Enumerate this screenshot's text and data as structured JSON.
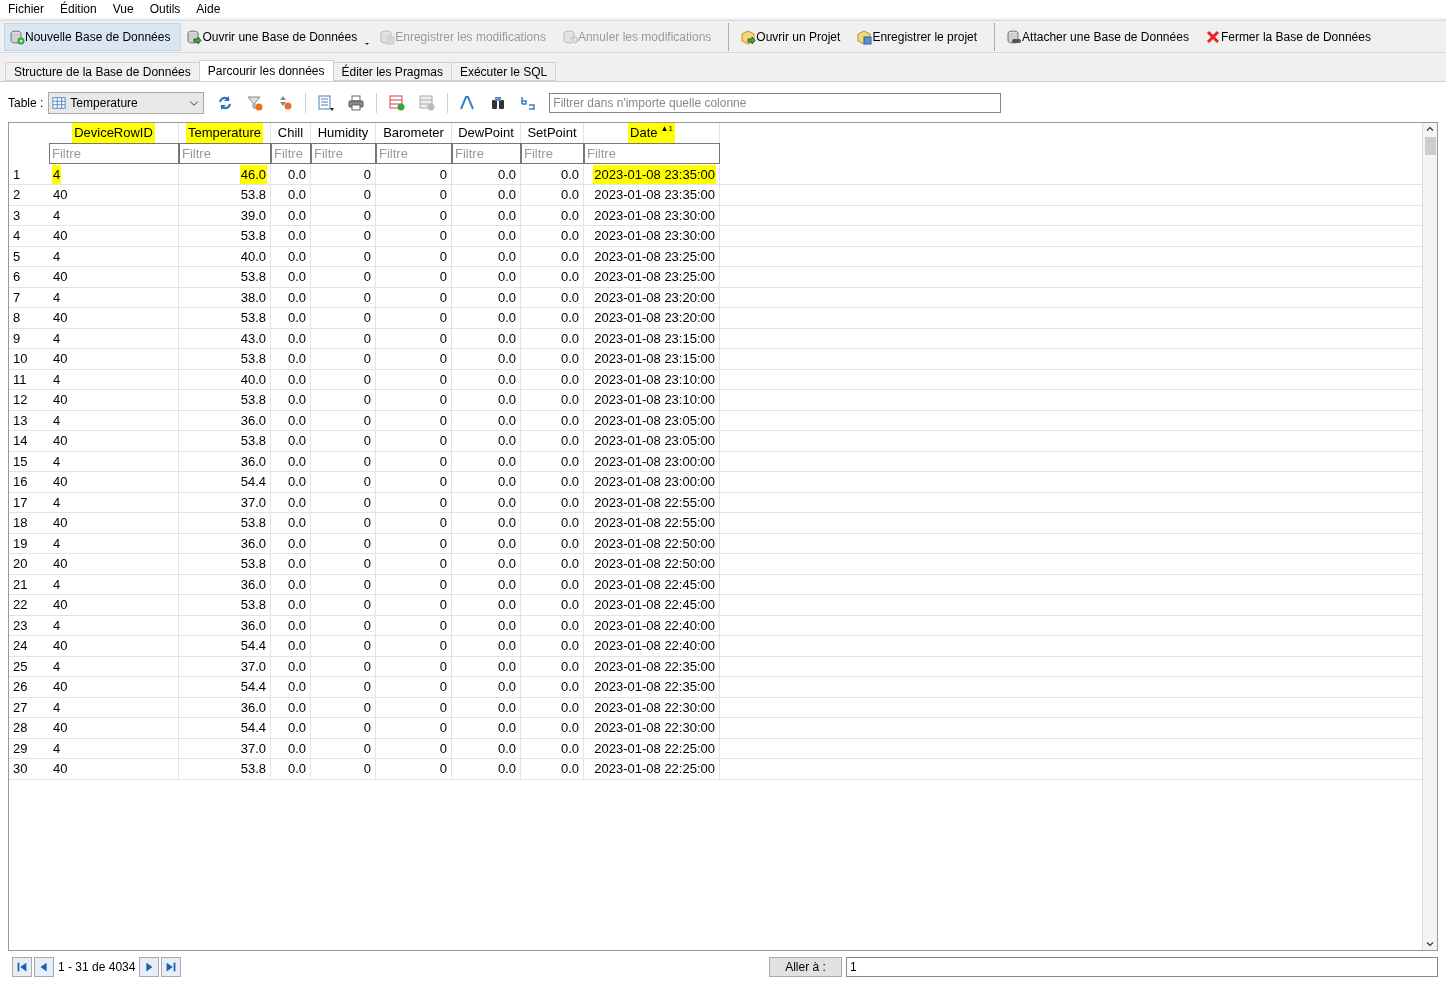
{
  "menu": [
    "Fichier",
    "Édition",
    "Vue",
    "Outils",
    "Aide"
  ],
  "toolbar": [
    [
      {
        "label": "Nouvelle Base de Données",
        "hovered": true,
        "disabled": false,
        "menu": false
      },
      {
        "label": "Ouvrir une Base de Données",
        "hovered": false,
        "disabled": false,
        "menu": true
      },
      {
        "label": "Enregistrer les modifications",
        "hovered": false,
        "disabled": true,
        "menu": false
      },
      {
        "label": "Annuler les modifications",
        "hovered": false,
        "disabled": true,
        "menu": false
      }
    ],
    [
      {
        "label": "Ouvrir un Projet",
        "hovered": false,
        "disabled": false,
        "menu": false
      },
      {
        "label": "Enregistrer le projet",
        "hovered": false,
        "disabled": false,
        "menu": false
      }
    ],
    [
      {
        "label": "Attacher une Base de Données",
        "hovered": false,
        "disabled": false,
        "menu": false
      },
      {
        "label": "Fermer la Base de Données",
        "hovered": false,
        "disabled": false,
        "menu": false
      }
    ]
  ],
  "tabs": [
    {
      "label": "Structure de la Base de Données",
      "selected": false
    },
    {
      "label": "Parcourir les données",
      "selected": true
    },
    {
      "label": "Éditer les Pragmas",
      "selected": false
    },
    {
      "label": "Exécuter le SQL",
      "selected": false
    }
  ],
  "table_label": "Table :",
  "table_select": "Temperature",
  "filter_all": {
    "placeholder": "Filtrer dans n'importe quelle colonne"
  },
  "columns": [
    {
      "name": "DeviceRowID",
      "kind": "text",
      "highlighted": true,
      "placeholder": "Filtre"
    },
    {
      "name": "Temperature",
      "kind": "number",
      "highlighted": true,
      "placeholder": "Filtre"
    },
    {
      "name": "Chill",
      "kind": "number",
      "highlighted": false,
      "placeholder": "Filtre"
    },
    {
      "name": "Humidity",
      "kind": "number",
      "highlighted": false,
      "placeholder": "Filtre"
    },
    {
      "name": "Barometer",
      "kind": "number",
      "highlighted": false,
      "placeholder": "Filtre"
    },
    {
      "name": "DewPoint",
      "kind": "number",
      "highlighted": false,
      "placeholder": "Filtre"
    },
    {
      "name": "SetPoint",
      "kind": "number",
      "highlighted": false,
      "placeholder": "Filtre"
    },
    {
      "name": "Date",
      "kind": "number",
      "highlighted": true,
      "placeholder": "Filtre",
      "sort": "▲1"
    }
  ],
  "rows": [
    {
      "number": "1",
      "cells": [
        "4",
        "46.0",
        "0.0",
        "0",
        "0",
        "0.0",
        "0.0",
        "2023-01-08 23:35:00"
      ],
      "highlights": [
        true,
        true,
        false,
        false,
        false,
        false,
        false,
        true
      ]
    },
    {
      "number": "2",
      "cells": [
        "40",
        "53.8",
        "0.0",
        "0",
        "0",
        "0.0",
        "0.0",
        "2023-01-08 23:35:00"
      ],
      "highlights": [
        false,
        false,
        false,
        false,
        false,
        false,
        false,
        false
      ]
    },
    {
      "number": "3",
      "cells": [
        "4",
        "39.0",
        "0.0",
        "0",
        "0",
        "0.0",
        "0.0",
        "2023-01-08 23:30:00"
      ],
      "highlights": [
        false,
        false,
        false,
        false,
        false,
        false,
        false,
        false
      ]
    },
    {
      "number": "4",
      "cells": [
        "40",
        "53.8",
        "0.0",
        "0",
        "0",
        "0.0",
        "0.0",
        "2023-01-08 23:30:00"
      ],
      "highlights": [
        false,
        false,
        false,
        false,
        false,
        false,
        false,
        false
      ]
    },
    {
      "number": "5",
      "cells": [
        "4",
        "40.0",
        "0.0",
        "0",
        "0",
        "0.0",
        "0.0",
        "2023-01-08 23:25:00"
      ],
      "highlights": [
        false,
        false,
        false,
        false,
        false,
        false,
        false,
        false
      ]
    },
    {
      "number": "6",
      "cells": [
        "40",
        "53.8",
        "0.0",
        "0",
        "0",
        "0.0",
        "0.0",
        "2023-01-08 23:25:00"
      ],
      "highlights": [
        false,
        false,
        false,
        false,
        false,
        false,
        false,
        false
      ]
    },
    {
      "number": "7",
      "cells": [
        "4",
        "38.0",
        "0.0",
        "0",
        "0",
        "0.0",
        "0.0",
        "2023-01-08 23:20:00"
      ],
      "highlights": [
        false,
        false,
        false,
        false,
        false,
        false,
        false,
        false
      ]
    },
    {
      "number": "8",
      "cells": [
        "40",
        "53.8",
        "0.0",
        "0",
        "0",
        "0.0",
        "0.0",
        "2023-01-08 23:20:00"
      ],
      "highlights": [
        false,
        false,
        false,
        false,
        false,
        false,
        false,
        false
      ]
    },
    {
      "number": "9",
      "cells": [
        "4",
        "43.0",
        "0.0",
        "0",
        "0",
        "0.0",
        "0.0",
        "2023-01-08 23:15:00"
      ],
      "highlights": [
        false,
        false,
        false,
        false,
        false,
        false,
        false,
        false
      ]
    },
    {
      "number": "10",
      "cells": [
        "40",
        "53.8",
        "0.0",
        "0",
        "0",
        "0.0",
        "0.0",
        "2023-01-08 23:15:00"
      ],
      "highlights": [
        false,
        false,
        false,
        false,
        false,
        false,
        false,
        false
      ]
    },
    {
      "number": "11",
      "cells": [
        "4",
        "40.0",
        "0.0",
        "0",
        "0",
        "0.0",
        "0.0",
        "2023-01-08 23:10:00"
      ],
      "highlights": [
        false,
        false,
        false,
        false,
        false,
        false,
        false,
        false
      ]
    },
    {
      "number": "12",
      "cells": [
        "40",
        "53.8",
        "0.0",
        "0",
        "0",
        "0.0",
        "0.0",
        "2023-01-08 23:10:00"
      ],
      "highlights": [
        false,
        false,
        false,
        false,
        false,
        false,
        false,
        false
      ]
    },
    {
      "number": "13",
      "cells": [
        "4",
        "36.0",
        "0.0",
        "0",
        "0",
        "0.0",
        "0.0",
        "2023-01-08 23:05:00"
      ],
      "highlights": [
        false,
        false,
        false,
        false,
        false,
        false,
        false,
        false
      ]
    },
    {
      "number": "14",
      "cells": [
        "40",
        "53.8",
        "0.0",
        "0",
        "0",
        "0.0",
        "0.0",
        "2023-01-08 23:05:00"
      ],
      "highlights": [
        false,
        false,
        false,
        false,
        false,
        false,
        false,
        false
      ]
    },
    {
      "number": "15",
      "cells": [
        "4",
        "36.0",
        "0.0",
        "0",
        "0",
        "0.0",
        "0.0",
        "2023-01-08 23:00:00"
      ],
      "highlights": [
        false,
        false,
        false,
        false,
        false,
        false,
        false,
        false
      ]
    },
    {
      "number": "16",
      "cells": [
        "40",
        "54.4",
        "0.0",
        "0",
        "0",
        "0.0",
        "0.0",
        "2023-01-08 23:00:00"
      ],
      "highlights": [
        false,
        false,
        false,
        false,
        false,
        false,
        false,
        false
      ]
    },
    {
      "number": "17",
      "cells": [
        "4",
        "37.0",
        "0.0",
        "0",
        "0",
        "0.0",
        "0.0",
        "2023-01-08 22:55:00"
      ],
      "highlights": [
        false,
        false,
        false,
        false,
        false,
        false,
        false,
        false
      ]
    },
    {
      "number": "18",
      "cells": [
        "40",
        "53.8",
        "0.0",
        "0",
        "0",
        "0.0",
        "0.0",
        "2023-01-08 22:55:00"
      ],
      "highlights": [
        false,
        false,
        false,
        false,
        false,
        false,
        false,
        false
      ]
    },
    {
      "number": "19",
      "cells": [
        "4",
        "36.0",
        "0.0",
        "0",
        "0",
        "0.0",
        "0.0",
        "2023-01-08 22:50:00"
      ],
      "highlights": [
        false,
        false,
        false,
        false,
        false,
        false,
        false,
        false
      ]
    },
    {
      "number": "20",
      "cells": [
        "40",
        "53.8",
        "0.0",
        "0",
        "0",
        "0.0",
        "0.0",
        "2023-01-08 22:50:00"
      ],
      "highlights": [
        false,
        false,
        false,
        false,
        false,
        false,
        false,
        false
      ]
    },
    {
      "number": "21",
      "cells": [
        "4",
        "36.0",
        "0.0",
        "0",
        "0",
        "0.0",
        "0.0",
        "2023-01-08 22:45:00"
      ],
      "highlights": [
        false,
        false,
        false,
        false,
        false,
        false,
        false,
        false
      ]
    },
    {
      "number": "22",
      "cells": [
        "40",
        "53.8",
        "0.0",
        "0",
        "0",
        "0.0",
        "0.0",
        "2023-01-08 22:45:00"
      ],
      "highlights": [
        false,
        false,
        false,
        false,
        false,
        false,
        false,
        false
      ]
    },
    {
      "number": "23",
      "cells": [
        "4",
        "36.0",
        "0.0",
        "0",
        "0",
        "0.0",
        "0.0",
        "2023-01-08 22:40:00"
      ],
      "highlights": [
        false,
        false,
        false,
        false,
        false,
        false,
        false,
        false
      ]
    },
    {
      "number": "24",
      "cells": [
        "40",
        "54.4",
        "0.0",
        "0",
        "0",
        "0.0",
        "0.0",
        "2023-01-08 22:40:00"
      ],
      "highlights": [
        false,
        false,
        false,
        false,
        false,
        false,
        false,
        false
      ]
    },
    {
      "number": "25",
      "cells": [
        "4",
        "37.0",
        "0.0",
        "0",
        "0",
        "0.0",
        "0.0",
        "2023-01-08 22:35:00"
      ],
      "highlights": [
        false,
        false,
        false,
        false,
        false,
        false,
        false,
        false
      ]
    },
    {
      "number": "26",
      "cells": [
        "40",
        "54.4",
        "0.0",
        "0",
        "0",
        "0.0",
        "0.0",
        "2023-01-08 22:35:00"
      ],
      "highlights": [
        false,
        false,
        false,
        false,
        false,
        false,
        false,
        false
      ]
    },
    {
      "number": "27",
      "cells": [
        "4",
        "36.0",
        "0.0",
        "0",
        "0",
        "0.0",
        "0.0",
        "2023-01-08 22:30:00"
      ],
      "highlights": [
        false,
        false,
        false,
        false,
        false,
        false,
        false,
        false
      ]
    },
    {
      "number": "28",
      "cells": [
        "40",
        "54.4",
        "0.0",
        "0",
        "0",
        "0.0",
        "0.0",
        "2023-01-08 22:30:00"
      ],
      "highlights": [
        false,
        false,
        false,
        false,
        false,
        false,
        false,
        false
      ]
    },
    {
      "number": "29",
      "cells": [
        "4",
        "37.0",
        "0.0",
        "0",
        "0",
        "0.0",
        "0.0",
        "2023-01-08 22:25:00"
      ],
      "highlights": [
        false,
        false,
        false,
        false,
        false,
        false,
        false,
        false
      ]
    },
    {
      "number": "30",
      "cells": [
        "40",
        "53.8",
        "0.0",
        "0",
        "0",
        "0.0",
        "0.0",
        "2023-01-08 22:25:00"
      ],
      "highlights": [
        false,
        false,
        false,
        false,
        false,
        false,
        false,
        false
      ]
    }
  ],
  "pager": {
    "range": "1 - 31 de 4034",
    "goto_label": "Aller à :",
    "goto_value": "1"
  }
}
